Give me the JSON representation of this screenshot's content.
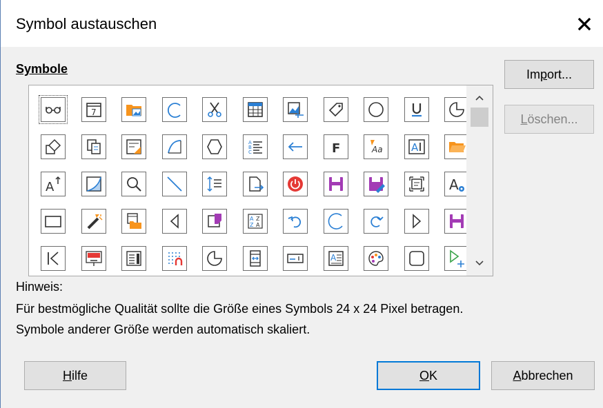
{
  "window": {
    "title": "Symbol austauschen",
    "close_icon": "close-x-icon"
  },
  "symbols": {
    "label": "Symbole",
    "rows": [
      [
        "glasses-icon",
        "calendar-icon",
        "folder-image-icon",
        "arc-icon",
        "scissors-icon",
        "table-icon",
        "image-crop-icon",
        "tag-icon",
        "circle-icon",
        "underline-icon",
        "pie-icon"
      ],
      [
        "shapes-rotate-icon",
        "copy-icon",
        "form-design-icon",
        "curve-icon",
        "hexagon-icon",
        "numbered-list-icon",
        "arrow-left-icon",
        "bold-icon",
        "font-effects-icon",
        "text-frame-icon",
        "folder-open-icon"
      ],
      [
        "font-grow-icon",
        "gradient-icon",
        "zoom-icon",
        "line-icon",
        "line-spacing-icon",
        "export-page-icon",
        "power-icon",
        "save-icon",
        "save-edit-icon",
        "select-frame-icon",
        "font-settings-icon"
      ],
      [
        "rectangle-icon",
        "magic-wand-icon",
        "calendar-folder-icon",
        "triangle-left-icon",
        "page-curl-icon",
        "sort-az-icon",
        "undo-icon",
        "arc-open-icon",
        "redo-icon",
        "triangle-right-icon",
        "save-alt-icon"
      ],
      [
        "first-record-icon",
        "presentation-icon",
        "form-list-icon",
        "grid-magnet-icon",
        "pie-outline-icon",
        "page-margins-icon",
        "text-field-icon",
        "text-box-icon",
        "palette-icon",
        "rounded-rect-icon",
        "play-add-icon"
      ]
    ]
  },
  "buttons": {
    "import": {
      "pre": "Im",
      "key": "p",
      "post": "ort..."
    },
    "delete": {
      "pre": "",
      "key": "L",
      "post": "öschen..."
    },
    "help": {
      "pre": "",
      "key": "H",
      "post": "ilfe"
    },
    "ok": {
      "pre": "",
      "key": "O",
      "post": "K"
    },
    "cancel": {
      "pre": "",
      "key": "A",
      "post": "bbrechen"
    }
  },
  "hint": {
    "label": "Hinweis:",
    "line1": "Für bestmögliche Qualität sollte die Größe eines Symbols 24 x 24 Pixel betragen.",
    "line2": "Symbole anderer Größe werden automatisch skaliert."
  },
  "colors": {
    "accent": "#0078d7",
    "blue_icon": "#2a7fd4",
    "orange_icon": "#f7941d",
    "purple_icon": "#a33bb5",
    "red_icon": "#e53935"
  }
}
